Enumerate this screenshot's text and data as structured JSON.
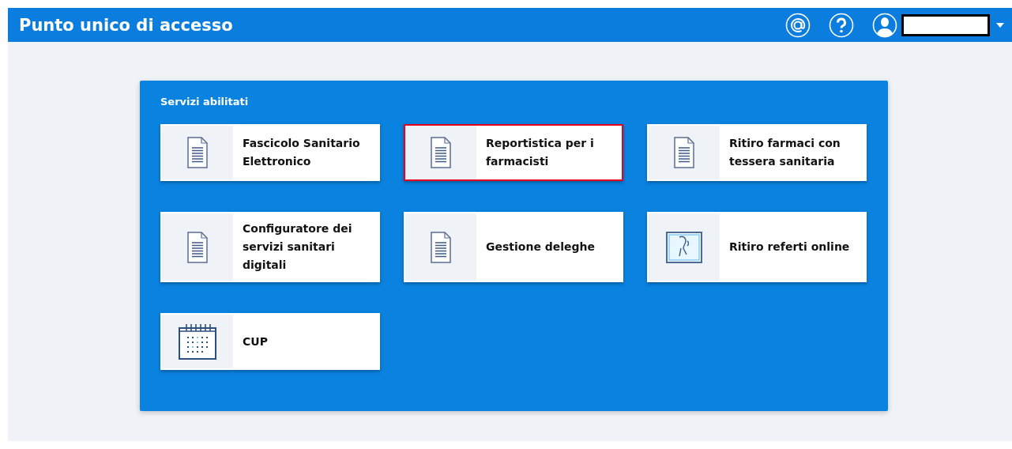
{
  "header": {
    "title": "Punto unico di accesso"
  },
  "panel": {
    "title": "Servizi abilitati",
    "tiles": [
      {
        "label": "Fascicolo Sanitario Elettronico",
        "kind": "document",
        "selected": false
      },
      {
        "label": "Reportistica per i farmacisti",
        "kind": "document",
        "selected": true
      },
      {
        "label": "Ritiro farmaci con tessera sanitaria",
        "kind": "document",
        "selected": false
      },
      {
        "label": "Configuratore dei servizi sanitari digitali",
        "kind": "document",
        "selected": false
      },
      {
        "label": "Gestione deleghe",
        "kind": "document",
        "selected": false
      },
      {
        "label": "Ritiro referti online",
        "kind": "xray",
        "selected": false
      },
      {
        "label": "CUP",
        "kind": "calendar",
        "selected": false
      }
    ]
  }
}
